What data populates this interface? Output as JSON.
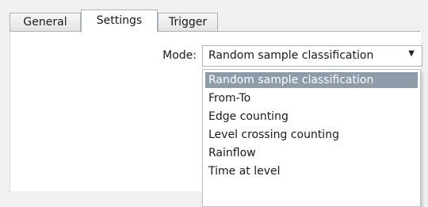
{
  "tabs": [
    {
      "label": "General"
    },
    {
      "label": "Settings"
    },
    {
      "label": "Trigger"
    }
  ],
  "mode": {
    "label": "Mode:",
    "value": "Random sample classification",
    "options": [
      "Random sample classification",
      "From-To",
      "Edge counting",
      "Level crossing counting",
      "Rainflow",
      "Time at level"
    ],
    "selected_index": 0
  },
  "icons": {
    "dropdown_arrow": "▼"
  },
  "colors": {
    "selected_bg": "#8e9bab",
    "selected_text": "#ffffff"
  }
}
